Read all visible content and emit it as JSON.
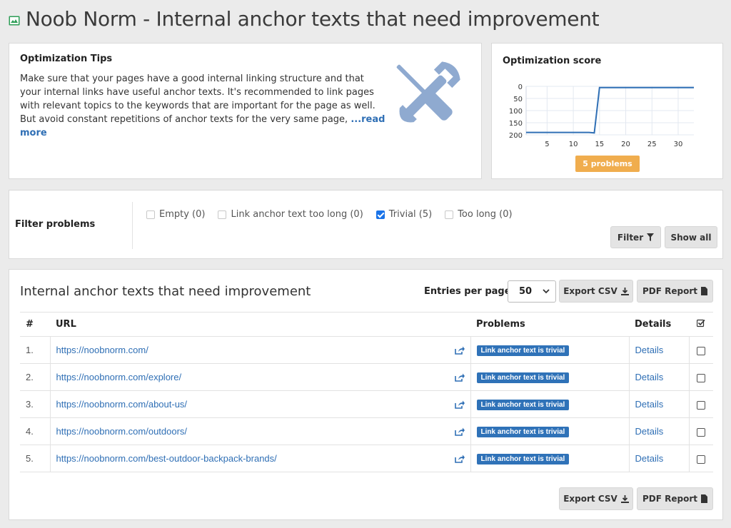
{
  "page": {
    "title": "Noob Norm - Internal anchor texts that need improvement",
    "accent": "#2f72b8"
  },
  "tips": {
    "title": "Optimization Tips",
    "text": "Make sure that your pages have a good internal linking structure and that your internal links have useful anchor texts. It's recommended to link pages with relevant topics to the keywords that are important for the page as well. But avoid constant repetitions of anchor texts for the very same page, ",
    "read_more": "...read more",
    "icon": "tools-icon"
  },
  "score": {
    "title": "Optimization score",
    "badge": "5 problems",
    "badge_color": "#f0ad4e",
    "chart_data": {
      "type": "line",
      "x": [
        1,
        2,
        3,
        4,
        5,
        6,
        7,
        8,
        9,
        10,
        11,
        12,
        13,
        14,
        15,
        16,
        17,
        18,
        19,
        20,
        21,
        22,
        23,
        24,
        25,
        26,
        27,
        28,
        29,
        30,
        31,
        32,
        33
      ],
      "y": [
        190,
        190,
        190,
        190,
        190,
        190,
        190,
        190,
        190,
        190,
        190,
        190,
        190,
        192,
        5,
        5,
        5,
        5,
        5,
        5,
        5,
        5,
        5,
        5,
        5,
        5,
        5,
        5,
        5,
        5,
        5,
        5,
        5
      ],
      "yticks": [
        "0",
        "50",
        "100",
        "150",
        "200"
      ],
      "xticks": [
        "5",
        "10",
        "15",
        "20",
        "25",
        "30"
      ],
      "ylim": [
        0,
        200
      ],
      "xlim": [
        1,
        33
      ],
      "y_inverted": true,
      "grid": true,
      "color": "#2f6fb5"
    }
  },
  "filter": {
    "label": "Filter problems",
    "options": [
      {
        "label": "Empty (0)",
        "checked": false
      },
      {
        "label": "Link anchor text too long (0)",
        "checked": false
      },
      {
        "label": "Trivial (5)",
        "checked": true
      },
      {
        "label": "Too long (0)",
        "checked": false
      }
    ],
    "filter_button": "Filter",
    "show_all_button": "Show all"
  },
  "table": {
    "title": "Internal anchor texts that need improvement",
    "entries_label": "Entries per page:",
    "entries_value": "50",
    "export_csv": "Export CSV",
    "pdf_report": "PDF Report",
    "columns": [
      "#",
      "URL",
      "Problems",
      "Details"
    ],
    "rows": [
      {
        "num": "1.",
        "url": "https://noobnorm.com/",
        "problem": "Link anchor text is trivial",
        "details": "Details"
      },
      {
        "num": "2.",
        "url": "https://noobnorm.com/explore/",
        "problem": "Link anchor text is trivial",
        "details": "Details"
      },
      {
        "num": "3.",
        "url": "https://noobnorm.com/about-us/",
        "problem": "Link anchor text is trivial",
        "details": "Details"
      },
      {
        "num": "4.",
        "url": "https://noobnorm.com/outdoors/",
        "problem": "Link anchor text is trivial",
        "details": "Details"
      },
      {
        "num": "5.",
        "url": "https://noobnorm.com/best-outdoor-backpack-brands/",
        "problem": "Link anchor text is trivial",
        "details": "Details"
      }
    ]
  }
}
